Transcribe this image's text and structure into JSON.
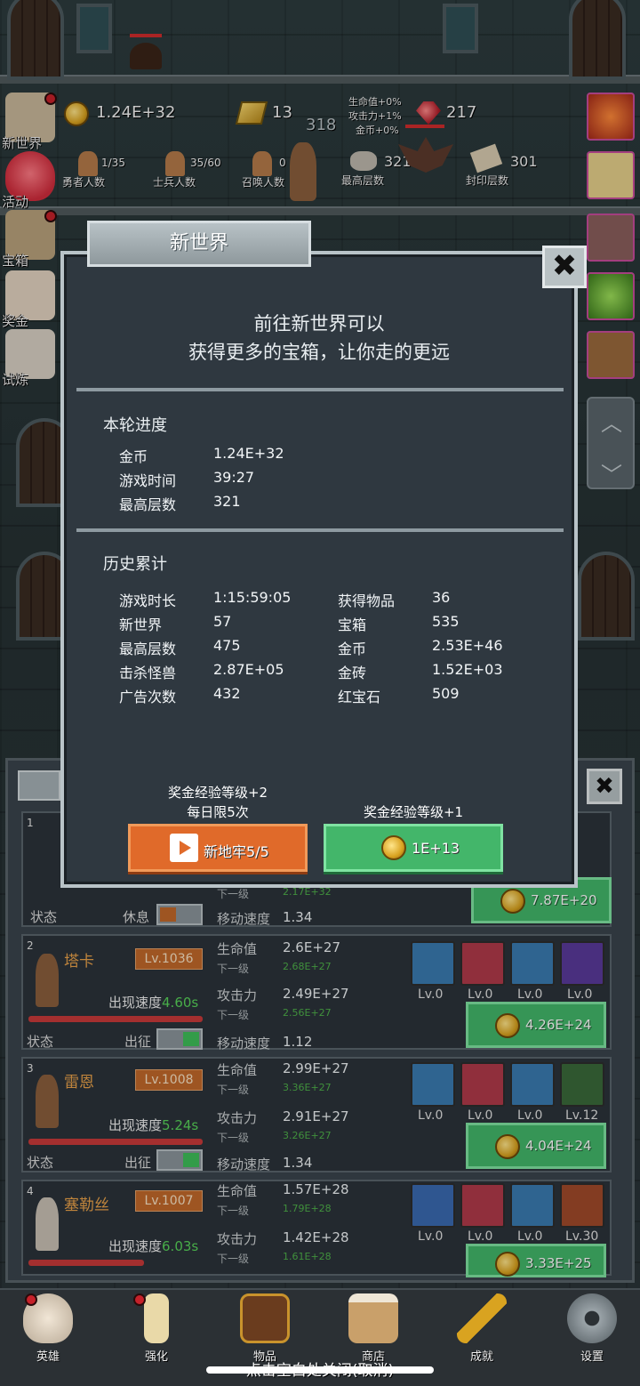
{
  "top": {
    "gold": "1.24E+32",
    "gold_bars": "13",
    "floor_center": "318",
    "ruby": "217",
    "buffs": [
      "生命值+0%",
      "攻击力+1%",
      "金币+0%"
    ],
    "heroes_count": "1/35",
    "heroes_label": "勇者人数",
    "soldiers_count": "35/60",
    "soldiers_label": "士兵人数",
    "summon_count": "0",
    "summon_label": "召唤人数",
    "max_floor": "321",
    "max_floor_label": "最高层数",
    "seal_floor": "301",
    "seal_floor_label": "封印层数"
  },
  "side_menu": [
    "新世界",
    "活动",
    "宝箱",
    "奖金",
    "试炼"
  ],
  "dialog": {
    "title": "新世界",
    "close": "✖",
    "intro_line1": "前往新世界可以",
    "intro_line2": "获得更多的宝箱，让你走的更远",
    "round_title": "本轮进度",
    "round": [
      {
        "k": "金币",
        "v": "1.24E+32"
      },
      {
        "k": "游戏时间",
        "v": "39:27"
      },
      {
        "k": "最高层数",
        "v": "321"
      }
    ],
    "history_title": "历史累计",
    "history_left": [
      {
        "k": "游戏时长",
        "v": "1:15:59:05"
      },
      {
        "k": "新世界",
        "v": "57"
      },
      {
        "k": "最高层数",
        "v": "475"
      },
      {
        "k": "击杀怪兽",
        "v": "2.87E+05"
      },
      {
        "k": "广告次数",
        "v": "432"
      }
    ],
    "history_right": [
      {
        "k": "获得物品",
        "v": "36"
      },
      {
        "k": "宝箱",
        "v": "535"
      },
      {
        "k": "金币",
        "v": "2.53E+46"
      },
      {
        "k": "金砖",
        "v": "1.52E+03"
      },
      {
        "k": "红宝石",
        "v": "509"
      }
    ],
    "bonus_left_1": "奖金经验等级+2",
    "bonus_left_2": "每日限5次",
    "bonus_right": "奖金经验等级+1",
    "btn_ad": "新地牢5/5",
    "btn_gold": "1E+13"
  },
  "hero_panel": {
    "close": "✖",
    "hero1": {
      "num": "1",
      "status_label": "状态",
      "status_value": "休息",
      "move_label": "移动速度",
      "move_value": "1.34",
      "next_label": "下一级",
      "next_value": "2.17E+32",
      "upgrade_cost": "7.87E+20"
    },
    "heroes": [
      {
        "num": "2",
        "name": "塔卡",
        "level": "Lv.1036",
        "speed_label": "出现速度",
        "speed": "4.60s",
        "status_label": "状态",
        "status_value": "出征",
        "hp_label": "生命值",
        "hp": "2.6E+27",
        "hp_next_label": "下一级",
        "hp_next": "2.68E+27",
        "atk_label": "攻击力",
        "atk": "2.49E+27",
        "atk_next_label": "下一级",
        "atk_next": "2.56E+27",
        "move_label": "移动速度",
        "move": "1.12",
        "equip": [
          "Lv.0",
          "Lv.0",
          "Lv.0",
          "Lv.0"
        ],
        "cost": "4.26E+24"
      },
      {
        "num": "3",
        "name": "雷恩",
        "level": "Lv.1008",
        "speed_label": "出现速度",
        "speed": "5.24s",
        "status_label": "状态",
        "status_value": "出征",
        "hp_label": "生命值",
        "hp": "2.99E+27",
        "hp_next_label": "下一级",
        "hp_next": "3.36E+27",
        "atk_label": "攻击力",
        "atk": "2.91E+27",
        "atk_next_label": "下一级",
        "atk_next": "3.26E+27",
        "move_label": "移动速度",
        "move": "1.34",
        "equip": [
          "Lv.0",
          "Lv.0",
          "Lv.0",
          "Lv.12"
        ],
        "cost": "4.04E+24"
      },
      {
        "num": "4",
        "name": "塞勒丝",
        "level": "Lv.1007",
        "speed_label": "出现速度",
        "speed": "6.03s",
        "hp_label": "生命值",
        "hp": "1.57E+28",
        "hp_next_label": "下一级",
        "hp_next": "1.79E+28",
        "atk_label": "攻击力",
        "atk": "1.42E+28",
        "atk_next_label": "下一级",
        "atk_next": "1.61E+28",
        "equip": [
          "Lv.0",
          "Lv.0",
          "Lv.0",
          "Lv.30"
        ],
        "cost": "3.33E+25"
      }
    ]
  },
  "nav": [
    "英雄",
    "强化",
    "物品",
    "商店",
    "成就",
    "设置"
  ],
  "hint": "点击空白处关闭(取消)"
}
